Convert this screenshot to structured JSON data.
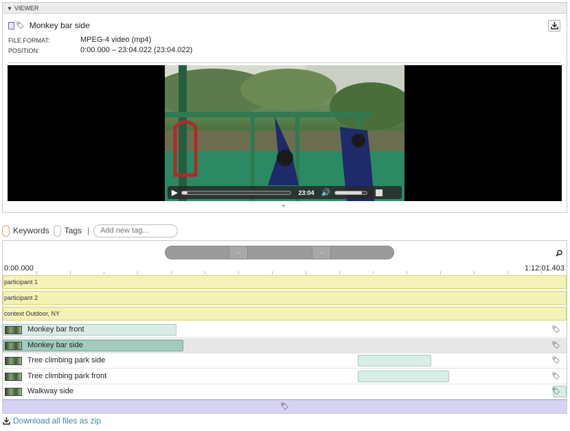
{
  "viewer": {
    "header_label": "VIEWER",
    "file_title": "Monkey bar side",
    "meta": [
      {
        "label": "FILE FORMAT:",
        "value": "MPEG-4 video (mp4)"
      },
      {
        "label": "POSITION:",
        "value": "0:00.000 – 23:04.022 (23:04.022)"
      }
    ],
    "player": {
      "time": "23:04",
      "progress": 0.05,
      "volume": 0.85
    }
  },
  "tagbar": {
    "keywords_label": "Keywords",
    "tags_label": "Tags",
    "separator": "|",
    "new_tag_placeholder": "Add new tag..."
  },
  "timeline": {
    "start_time": "0:00.000",
    "end_time": "1:12:01.403",
    "contexts": [
      {
        "label": "participant 1"
      },
      {
        "label": "participant 2"
      },
      {
        "label": "context Outdoor, NY"
      }
    ],
    "files": [
      {
        "name": "Monkey bar front",
        "selected": false,
        "bar_start": 0.0,
        "bar_end": 0.307
      },
      {
        "name": "Monkey bar side",
        "selected": true,
        "bar_start": 0.0,
        "bar_end": 0.32
      },
      {
        "name": "Tree climbing park side",
        "selected": false,
        "bar_start": 0.628,
        "bar_end": 0.758
      },
      {
        "name": "Tree climbing park front",
        "selected": false,
        "bar_start": 0.628,
        "bar_end": 0.79
      },
      {
        "name": "Walkway side",
        "selected": false,
        "bar_start": 0.973,
        "bar_end": 0.998
      }
    ]
  },
  "footer": {
    "download_all_label": "Download all files as zip"
  },
  "colors": {
    "context_bg": "#f5f2b8",
    "segment_bg": "#d9ede7",
    "segment_selected": "#a3cbbe",
    "add_row_bg": "#d6d3f4",
    "link": "#3a8aa0"
  }
}
